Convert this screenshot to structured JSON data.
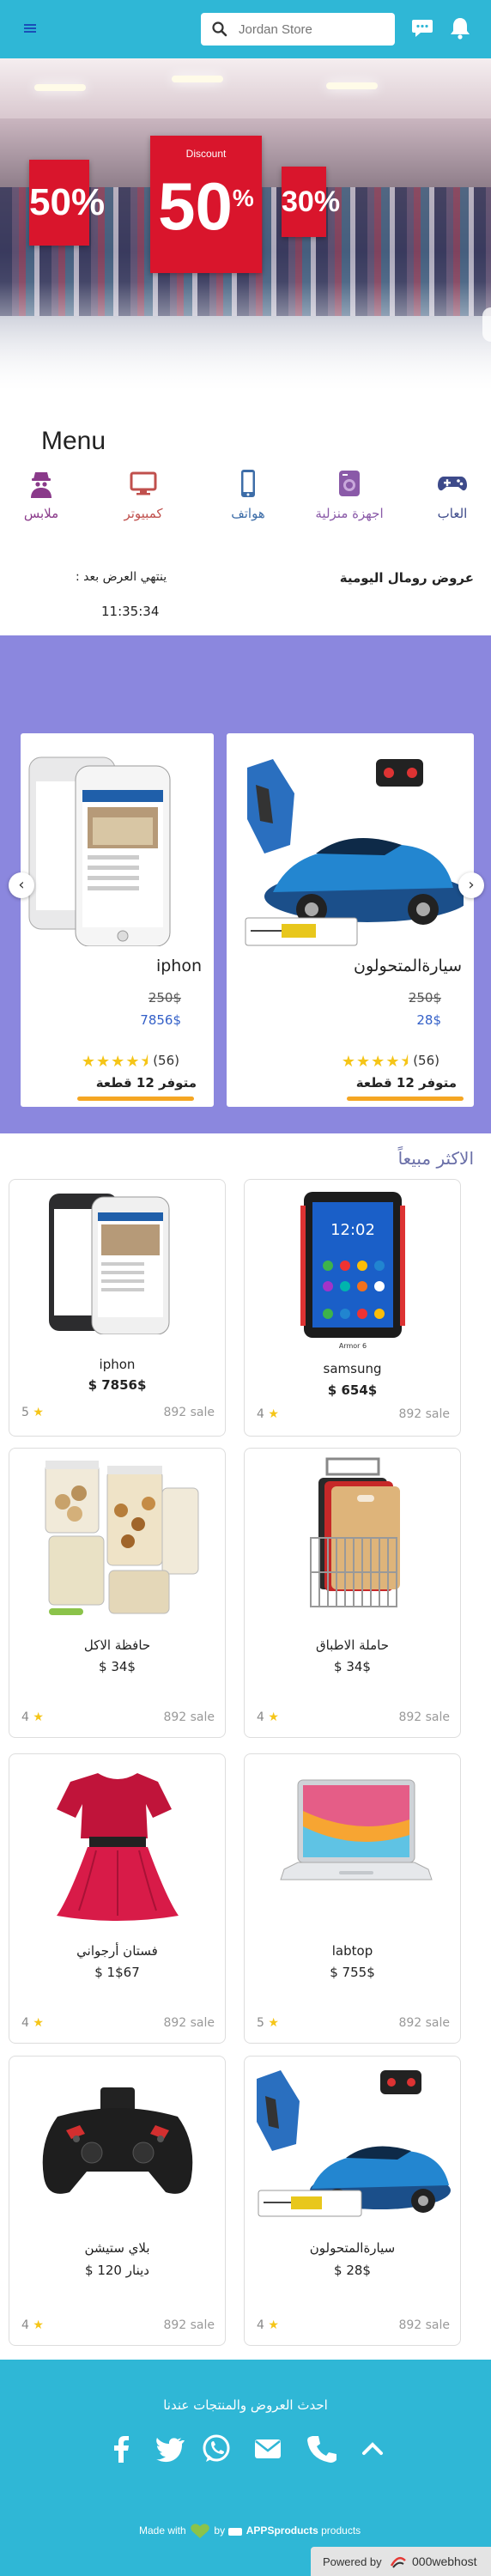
{
  "header": {
    "search_placeholder": "Jordan Store",
    "icons": [
      "menu-icon",
      "search-icon",
      "chat-icon",
      "bell-icon"
    ],
    "accent": "#2fb7d6"
  },
  "hero": {
    "signs": [
      "50%",
      "Discount",
      "50",
      "%",
      "30%"
    ]
  },
  "menu": {
    "title": "Menu",
    "categories": [
      {
        "label": "العاب",
        "icon": "gamepad-icon"
      },
      {
        "label": "اجهزة منزلية",
        "icon": "appliance-icon"
      },
      {
        "label": "هواتف",
        "icon": "phone-icon"
      },
      {
        "label": "كمبيوتر",
        "icon": "computer-icon"
      },
      {
        "label": "ملابس",
        "icon": "clothing-icon"
      }
    ]
  },
  "deals": {
    "title": "عروض رومال اليومية",
    "ends_label": "ينتهي العرض بعد :",
    "countdown": "11:35:34",
    "band_color": "#8b87de",
    "products": [
      {
        "name": "سيارةالمتحولون",
        "old_price": "250$",
        "new_price": "28$",
        "stars": "★★★★⯨",
        "reviews": "(56)",
        "stock": "متوفر 12 قطعة"
      },
      {
        "name": "iphon",
        "old_price": "250$",
        "new_price": "7856$",
        "stars": "★★★★⯨",
        "reviews": "(56)",
        "stock": "متوفر 12 قطعة"
      }
    ]
  },
  "best_sellers": {
    "title": "الاكثر مبيعاً",
    "products": [
      {
        "name": "iphon",
        "price": "$ 7856$",
        "rating": "5",
        "sales": "892 sale"
      },
      {
        "name": "samsung",
        "price": "$ 654$",
        "rating": "4",
        "sales": "892 sale",
        "caption": "Armor 6"
      },
      {
        "name": "حافظة الاكل",
        "price": "$ 34$",
        "rating": "4",
        "sales": "892 sale"
      },
      {
        "name": "حاملة الاطباق",
        "price": "$ 34$",
        "rating": "4",
        "sales": "892 sale"
      },
      {
        "name": "فستان أرجواني",
        "price": "$ 1$67",
        "rating": "4",
        "sales": "892 sale"
      },
      {
        "name": "labtop",
        "price": "$ 755$",
        "rating": "5",
        "sales": "892 sale"
      },
      {
        "name": "بلاي ستيشن",
        "price": "$ 120 دينار",
        "rating": "4",
        "sales": "892 sale"
      },
      {
        "name": "سيارةالمتحولون",
        "price": "$ 28$",
        "rating": "4",
        "sales": "892 sale"
      }
    ]
  },
  "footer": {
    "title": "احدث العروض والمنتجات عندنا",
    "social": [
      "facebook-icon",
      "twitter-icon",
      "whatsapp-icon",
      "mail-icon",
      "phone-call-icon",
      "chevron-up-icon"
    ],
    "made_with": "Made with",
    "by": "by",
    "brand": "APPSproducts",
    "products_word": "products",
    "powered_by": "Powered by",
    "host": "000webhost"
  }
}
